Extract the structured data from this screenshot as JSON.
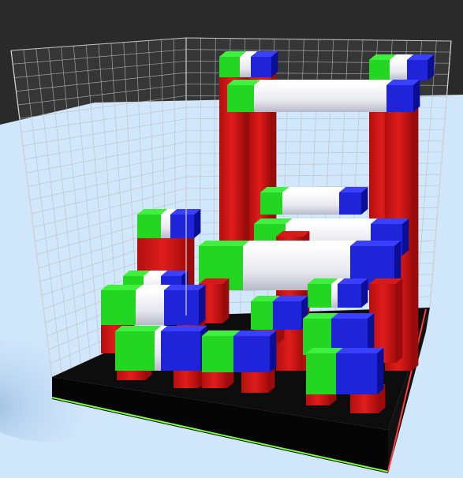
{
  "scene": {
    "colors": {
      "sky": "#2a2a2a",
      "floor": "#cfe6fb",
      "floor_shadow": "#a9c9ea",
      "base_top": "#0c0c0c",
      "base_front": "#050505",
      "base_edge_x": "#ff3b3b",
      "base_edge_z": "#7cff3b",
      "grid": "#bdbdbd",
      "red": "#d61a1a",
      "red_dark": "#9a0b0b",
      "red_side": "#b30f0f",
      "white": "#f2f2f2",
      "white_shade": "#c9c9d6",
      "green": "#22d622",
      "green_dark": "#129a12",
      "blue": "#1f24d9",
      "blue_dark": "#0b0f96"
    },
    "pieces": [
      {
        "name": "tall-frame-left-post"
      },
      {
        "name": "tall-frame-right-post"
      },
      {
        "name": "tall-frame-top-beam"
      },
      {
        "name": "mid-beam-upper"
      },
      {
        "name": "mid-beam-long"
      },
      {
        "name": "mid-beam-front"
      },
      {
        "name": "left-tower"
      },
      {
        "name": "front-left-bridge"
      },
      {
        "name": "front-row-piece-1"
      },
      {
        "name": "front-row-piece-2"
      },
      {
        "name": "front-right-piece"
      },
      {
        "name": "right-lower-bridge"
      }
    ]
  }
}
